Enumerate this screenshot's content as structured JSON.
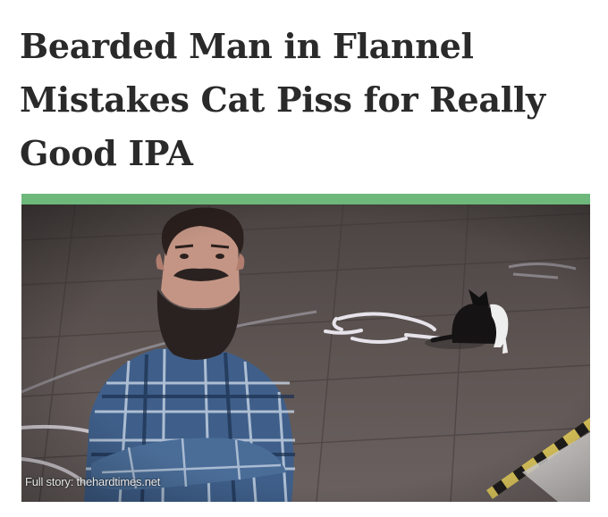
{
  "article": {
    "headline_lines": [
      "Bearded Man in Flannel",
      "Mistakes Cat Piss for Really",
      "Good IPA"
    ],
    "accent_color": "#6db87a",
    "photo": {
      "subjects": [
        "bearded-man-in-flannel",
        "black-and-white-cat"
      ],
      "credit": "Full story: thehardtimes.net"
    }
  }
}
